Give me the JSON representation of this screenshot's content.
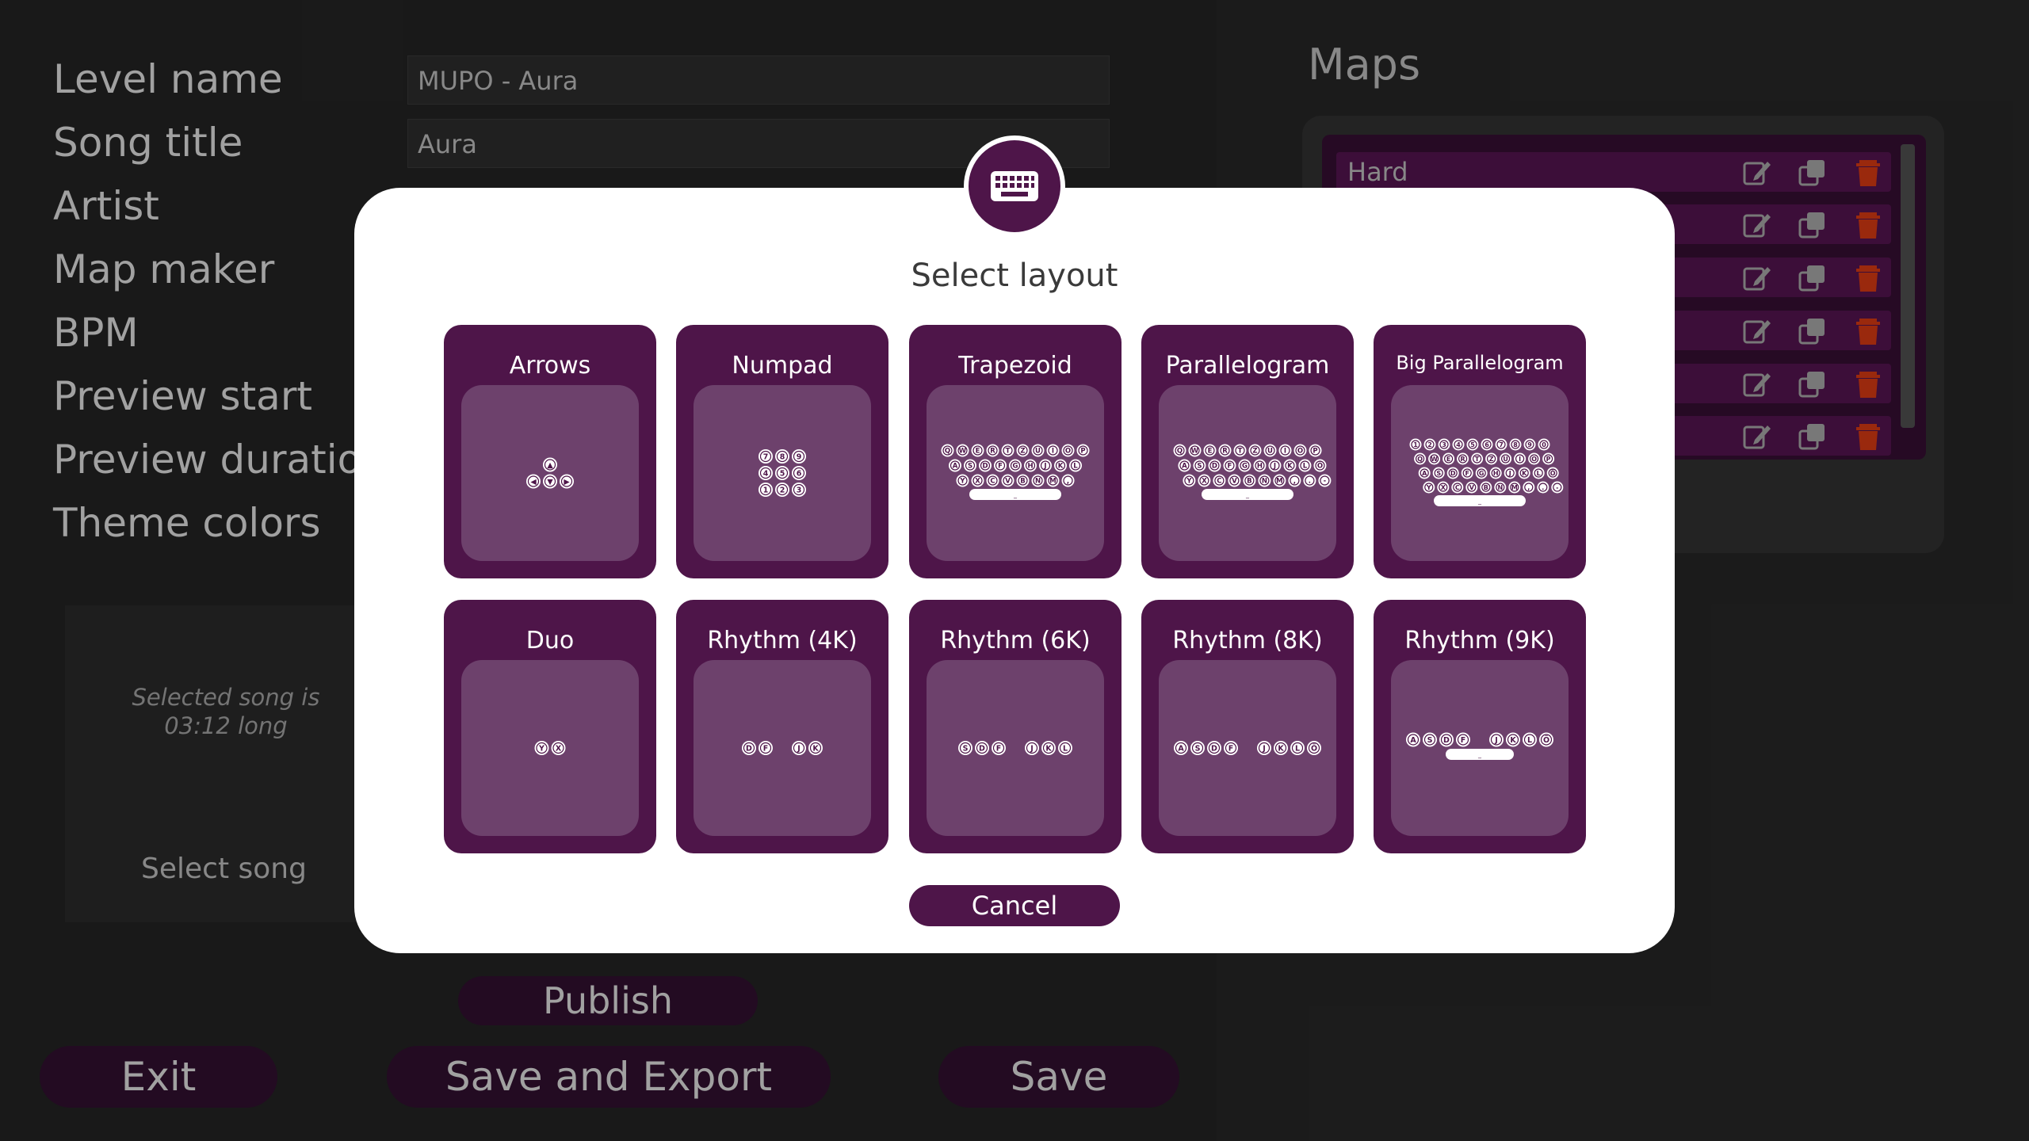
{
  "editor": {
    "fields": [
      {
        "label": "Level name",
        "value": "MUPO - Aura"
      },
      {
        "label": "Song title",
        "value": "Aura"
      },
      {
        "label": "Artist"
      },
      {
        "label": "Map maker"
      },
      {
        "label": "BPM"
      },
      {
        "label": "Preview start"
      },
      {
        "label": "Preview duration"
      },
      {
        "label": "Theme colors"
      }
    ],
    "song_info": "Selected song is 03:12 long",
    "select_song_label": "Select song",
    "publish_label": "Publish",
    "exit_label": "Exit",
    "save_export_label": "Save and Export",
    "save_label": "Save"
  },
  "maps": {
    "title": "Maps",
    "items": [
      {
        "name": "Hard"
      },
      {
        "name": ""
      },
      {
        "name": ""
      },
      {
        "name": ""
      },
      {
        "name": ""
      },
      {
        "name": ""
      }
    ],
    "icons": [
      "edit-icon",
      "duplicate-icon",
      "trash-icon"
    ]
  },
  "modal": {
    "title": "Select layout",
    "badge_icon": "keyboard-icon",
    "layouts": [
      {
        "name": "Arrows",
        "rows": [
          [
            "▲"
          ],
          [
            "◀",
            "▼",
            "▶"
          ]
        ]
      },
      {
        "name": "Numpad",
        "rows": [
          [
            "7",
            "8",
            "9"
          ],
          [
            "4",
            "5",
            "6"
          ],
          [
            "1",
            "2",
            "3"
          ]
        ]
      },
      {
        "name": "Trapezoid",
        "rows": [
          [
            "Q",
            "W",
            "E",
            "R",
            "T",
            "Z",
            "U",
            "I",
            "O",
            "P"
          ],
          [
            "A",
            "S",
            "D",
            "F",
            "G",
            "H",
            "J",
            "K",
            "L"
          ],
          [
            "Y",
            "X",
            "C",
            "V",
            "B",
            "N",
            "M",
            ","
          ]
        ],
        "space": "_"
      },
      {
        "name": "Parallelogram",
        "rows": [
          [
            "Q",
            "W",
            "E",
            "R",
            "T",
            "Z",
            "U",
            "I",
            "O",
            "P"
          ],
          [
            "A",
            "S",
            "D",
            "F",
            "G",
            "H",
            "J",
            "K",
            "L",
            "Ö"
          ],
          [
            "Y",
            "X",
            "C",
            "V",
            "B",
            "N",
            "M",
            ",",
            ".",
            "-"
          ]
        ],
        "space": "_"
      },
      {
        "name": "Big Parallelogram",
        "rows": [
          [
            "1",
            "2",
            "3",
            "4",
            "5",
            "6",
            "7",
            "8",
            "9",
            "0"
          ],
          [
            "Q",
            "W",
            "E",
            "R",
            "T",
            "Z",
            "U",
            "I",
            "O",
            "P"
          ],
          [
            "A",
            "S",
            "D",
            "F",
            "G",
            "H",
            "J",
            "K",
            "L",
            "Ö"
          ],
          [
            "Y",
            "X",
            "C",
            "V",
            "B",
            "N",
            "M",
            ",",
            ".",
            "-"
          ]
        ],
        "space": "_"
      },
      {
        "name": "Duo",
        "rows": [
          [
            "Y",
            "X"
          ]
        ]
      },
      {
        "name": "Rhythm (4K)",
        "rows": [
          [
            "D",
            "F",
            "",
            "J",
            "K"
          ]
        ]
      },
      {
        "name": "Rhythm (6K)",
        "rows": [
          [
            "S",
            "D",
            "F",
            "",
            "J",
            "K",
            "L"
          ]
        ]
      },
      {
        "name": "Rhythm (8K)",
        "rows": [
          [
            "A",
            "S",
            "D",
            "F",
            "",
            "J",
            "K",
            "L",
            "Ö"
          ]
        ]
      },
      {
        "name": "Rhythm (9K)",
        "rows": [
          [
            "A",
            "S",
            "D",
            "F",
            "",
            "J",
            "K",
            "L",
            "Ö"
          ]
        ],
        "space": "_"
      }
    ],
    "cancel_label": "Cancel"
  },
  "colors": {
    "accent": "#4e1549",
    "preview_bg": "#6d416c",
    "trash": "#9c2a0e"
  }
}
